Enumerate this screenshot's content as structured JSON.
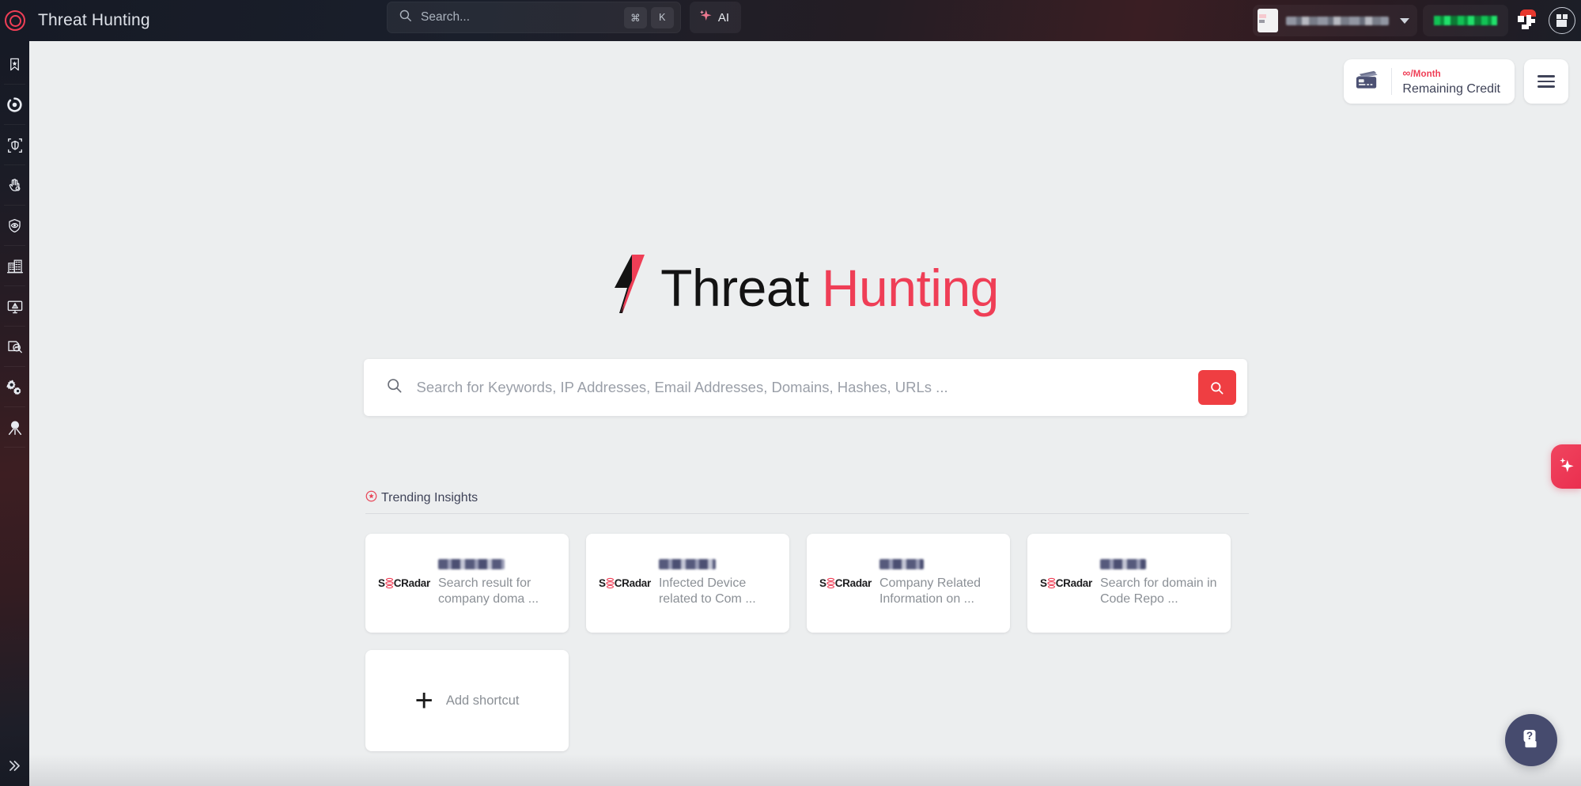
{
  "topbar": {
    "brand_icon": "socradar-ring-logo",
    "title": "Threat Hunting",
    "search": {
      "placeholder": "Search...",
      "icon": "search-icon",
      "kbd_cmd": "⌘",
      "kbd_key": "K"
    },
    "ai_button": {
      "label": "AI",
      "icon": "sparkle-icon"
    },
    "user": {
      "name_redacted": "██████",
      "chevron_icon": "chevron-down-icon",
      "avatar_icon": "avatar"
    },
    "license_chip": {
      "value_redacted": "█████"
    },
    "notification_icon": "notification-icon",
    "profile_icon": "profile-avatar-icon"
  },
  "sidebar": {
    "items": [
      {
        "name": "bookmark-star-icon",
        "label": "Bookmarks"
      },
      {
        "name": "attack-surface-icon",
        "label": "Attack Surface"
      },
      {
        "name": "shield-scan-icon",
        "label": "Digital Risk Protection"
      },
      {
        "name": "hand-icon",
        "label": "Brand Protection"
      },
      {
        "name": "shield-eye-icon",
        "label": "Dark Web Monitoring"
      },
      {
        "name": "building-icon",
        "label": "Supply Chain"
      },
      {
        "name": "monitor-alert-icon",
        "label": "Cyber Threat Intelligence"
      },
      {
        "name": "document-search-icon",
        "label": "Vulnerability Intelligence"
      },
      {
        "name": "gears-icon",
        "label": "Integrations"
      },
      {
        "name": "threat-hunting-icon",
        "label": "Threat Hunting"
      }
    ],
    "expand_icon": "chevron-double-right-icon",
    "expand_label": "Expand"
  },
  "credit": {
    "icon": "credit-card-icon",
    "amount": "∞",
    "period": "/Month",
    "label": "Remaining Credit",
    "menu_icon": "hamburger-menu-icon"
  },
  "hero": {
    "bolt_icon": "lightning-bolt-icon",
    "title_part1": "Threat",
    "title_part2": "Hunting",
    "search": {
      "icon": "search-icon",
      "placeholder": "Search for Keywords, IP Addresses, Email Addresses, Domains, Hashes, URLs ...",
      "value": "",
      "button_icon": "search-icon"
    }
  },
  "trending": {
    "icon": "trending-star-icon",
    "label": "Trending Insights",
    "cards": [
      {
        "logo": "SOCRadar",
        "title_redacted": "████",
        "desc": "Search result for company doma ..."
      },
      {
        "logo": "SOCRadar",
        "title_redacted": "████",
        "desc": "Infected Device related to Com ..."
      },
      {
        "logo": "SOCRadar",
        "title_redacted": "████",
        "desc": "Company Related Information on ..."
      },
      {
        "logo": "SOCRadar",
        "title_redacted": "████",
        "desc": "Search for domain in Code Repo ..."
      }
    ],
    "add_shortcut": {
      "icon": "plus-icon",
      "label": "Add shortcut"
    }
  },
  "floating": {
    "ai_tab_icon": "ai-sparkle-icon",
    "help_icon": "help-question-icon"
  },
  "colors": {
    "accent_red": "#ef3e56",
    "search_button": "#ef3e42",
    "topbar_dark": "#1a1f2b",
    "page_bg": "#eceeef",
    "navy": "#464b6e"
  }
}
